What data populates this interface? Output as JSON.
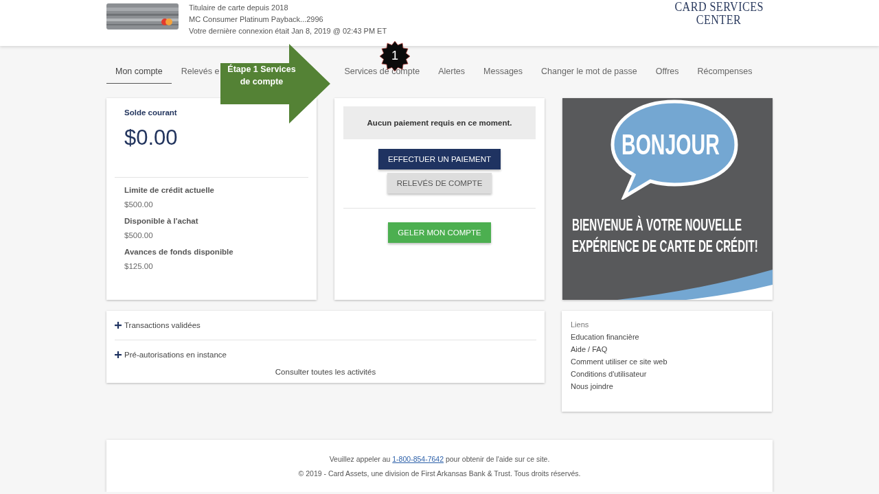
{
  "header": {
    "card_lines": [
      "Titulaire de carte depuis 2018",
      "MC Consumer Platinum Payback...2996",
      "Votre dernière connexion était Jan 8, 2019 @ 02:43 PM ET"
    ],
    "logo": [
      "CARD SERVICES",
      "CENTER"
    ]
  },
  "tabs": [
    {
      "label": "Mon compte",
      "selected": true
    },
    {
      "label": "Relevés e",
      "selected": false,
      "covered": true
    },
    {
      "label": "Services de compte",
      "selected": false
    },
    {
      "label": "Alertes",
      "selected": false
    },
    {
      "label": "Messages",
      "selected": false
    },
    {
      "label": "Changer le mot de passe",
      "selected": false
    },
    {
      "label": "Offres",
      "selected": false
    },
    {
      "label": "Récompenses",
      "selected": false
    }
  ],
  "callout": {
    "text": "Étape 1 Services de compte",
    "badge": "1"
  },
  "balance": {
    "label": "Solde courant",
    "amount": "$0.00",
    "details": [
      {
        "label": "Limite de crédit actuelle",
        "value": "$500.00"
      },
      {
        "label": "Disponible à l'achat",
        "value": "$500.00"
      },
      {
        "label": "Avances de fonds disponible",
        "value": "$125.00"
      }
    ]
  },
  "payment": {
    "notice": "Aucun paiement requis en ce moment.",
    "buttons": [
      {
        "label": "EFFECTUER UN PAIEMENT",
        "kind": "primary"
      },
      {
        "label": "RELEVÉS DE COMPTE",
        "kind": "secondary"
      }
    ],
    "freeze_button": "GELER MON COMPTE"
  },
  "banner": {
    "bubble": "BONJOUR",
    "lines": [
      "BIENVENUE À VOTRE NOUVELLE",
      "EXPÉRIENCE DE CARTE DE CRÉDIT!"
    ]
  },
  "activity": {
    "sections": [
      {
        "label": "Transactions validées",
        "expanded": false
      },
      {
        "label": "Pré-autorisations en instance",
        "expanded": false
      }
    ],
    "link": "Consulter toutes les activités"
  },
  "links": {
    "title": "Liens",
    "items": [
      "Education financière",
      "Aide / FAQ",
      "Comment utiliser ce site web",
      "Conditions d'utilisateur",
      "Nous joindre"
    ]
  },
  "footer": {
    "before": "Veuillez appeler au",
    "phone": "1-800-854-7642",
    "after": "pour obtenir de l'aide sur ce site.",
    "copyright": "© 2019 - Card Assets, une division de First Arkansas Bank & Trust. Tous droits réservés."
  }
}
